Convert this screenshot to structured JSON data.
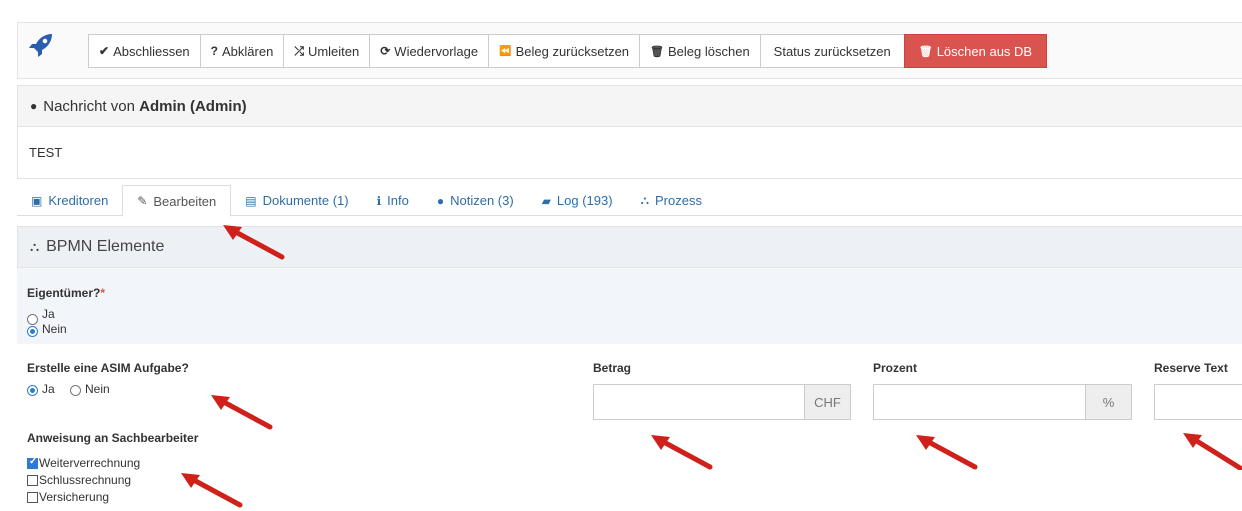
{
  "toolbar": {
    "buttons": [
      {
        "icon": "✔",
        "label": "Abschliessen"
      },
      {
        "icon": "?",
        "label": "Abklären"
      },
      {
        "icon": "⤮",
        "label": "Umleiten"
      },
      {
        "icon": "⟳",
        "label": "Wiedervorlage"
      },
      {
        "icon": "⏪",
        "label": "Beleg zurücksetzen"
      },
      {
        "icon": "🗑",
        "label": "Beleg löschen"
      },
      {
        "icon": "",
        "label": "Status zurücksetzen"
      },
      {
        "icon": "🗑",
        "label": "Löschen aus DB"
      }
    ],
    "danger_color": "#d9534f"
  },
  "message": {
    "prefix": "Nachricht von",
    "sender": "Admin (Admin)",
    "body": "TEST"
  },
  "tabs": [
    {
      "icon": "▣",
      "label": "Kreditoren",
      "active": false
    },
    {
      "icon": "✎",
      "label": "Bearbeiten",
      "active": true
    },
    {
      "icon": "▤",
      "label": "Dokumente (1)",
      "active": false
    },
    {
      "icon": "ℹ",
      "label": "Info",
      "active": false
    },
    {
      "icon": "●",
      "label": "Notizen (3)",
      "active": false
    },
    {
      "icon": "▰",
      "label": "Log (193)",
      "active": false
    },
    {
      "icon": "⛬",
      "label": "Prozess",
      "active": false
    }
  ],
  "bpmn": {
    "title": "BPMN Elemente",
    "eigentuemer": {
      "label": "Eigentümer?",
      "required": "*",
      "options": [
        "Ja",
        "Nein"
      ],
      "selected": "Nein"
    },
    "asim": {
      "label": "Erstelle eine ASIM Aufgabe?",
      "options": [
        "Ja",
        "Nein"
      ],
      "selected": "Ja"
    },
    "anweisung": {
      "label": "Anweisung an Sachbearbeiter",
      "items": [
        {
          "label": "Weiterverrechnung",
          "checked": true
        },
        {
          "label": "Schlussrechnung",
          "checked": false
        },
        {
          "label": "Versicherung",
          "checked": false
        }
      ]
    },
    "betrag": {
      "label": "Betrag",
      "value": "",
      "addon": "CHF"
    },
    "prozent": {
      "label": "Prozent",
      "value": "",
      "addon": "%"
    },
    "reserve": {
      "label": "Reserve Text",
      "value": ""
    }
  },
  "accent_color": "#2d6ea8",
  "annotation_arrow_color": "#d0201a"
}
